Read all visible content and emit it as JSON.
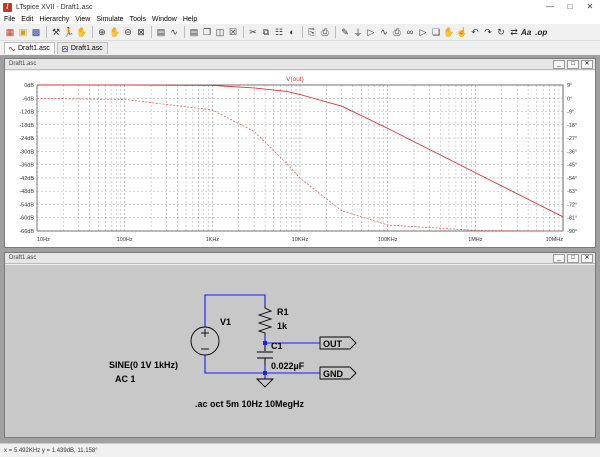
{
  "window": {
    "title": "LTspice XVII - Draft1.asc"
  },
  "menu": [
    "File",
    "Edit",
    "Hierarchy",
    "View",
    "Simulate",
    "Tools",
    "Window",
    "Help"
  ],
  "toolbar": {
    "text_tool": "Aa",
    "op_tool": ".op"
  },
  "tabs": [
    "Draft1.asc",
    "Draft1.asc"
  ],
  "waveform_window": {
    "title": "Draft1.asc"
  },
  "schematic_window": {
    "title": "Draft1.asc"
  },
  "chart_data": {
    "type": "line",
    "title": "V(out)",
    "x_scale": "log",
    "x_ticks": [
      "10Hz",
      "100Hz",
      "1KHz",
      "10KHz",
      "100KHz",
      "1MHz",
      "10MHz"
    ],
    "x_tick_values": [
      10,
      100,
      1000,
      10000,
      100000,
      1000000,
      10000000
    ],
    "xlim": [
      10,
      10000000
    ],
    "y_left_ticks": [
      "0dB",
      "-6dB",
      "-12dB",
      "-18dB",
      "-24dB",
      "-30dB",
      "-36dB",
      "-42dB",
      "-48dB",
      "-54dB",
      "-60dB",
      "-66dB"
    ],
    "y_left_lim": [
      -66,
      0
    ],
    "y_right_ticks": [
      "9°",
      "0°",
      "-9°",
      "-18°",
      "-27°",
      "-36°",
      "-45°",
      "-54°",
      "-63°",
      "-72°",
      "-81°",
      "-90°"
    ],
    "y_right_lim": [
      -90,
      9
    ],
    "grid": true,
    "series": [
      {
        "name": "magnitude",
        "axis": "left",
        "style": "solid",
        "color": "#e03030",
        "x": [
          10,
          100,
          1000,
          3000,
          7234,
          10000,
          30000,
          100000,
          1000000,
          5000000,
          10000000
        ],
        "y": [
          0,
          0,
          -0.2,
          -1.3,
          -3.0,
          -4.3,
          -9.6,
          -19.6,
          -39.6,
          -53.6,
          -59.6
        ]
      },
      {
        "name": "phase",
        "axis": "right",
        "style": "dashed",
        "color": "#e06060",
        "x": [
          10,
          100,
          1000,
          3000,
          7234,
          10000,
          30000,
          100000,
          1000000,
          10000000
        ],
        "y": [
          -0.1,
          -0.8,
          -7.9,
          -22.5,
          -45,
          -54.1,
          -76.4,
          -85.9,
          -89.6,
          -90
        ]
      }
    ]
  },
  "schematic": {
    "source_name": "V1",
    "source_value": "SINE(0 1V 1kHz)",
    "source_ac": "AC 1",
    "r1_name": "R1",
    "r1_value": "1k",
    "c1_name": "C1",
    "c1_value": "0.022µF",
    "label_out": "OUT",
    "label_gnd": "GND",
    "directive": ".ac oct 5m 10Hz 10MegHz"
  },
  "status": {
    "cursor": "x = 5.492KHz   y = 1.439dB, 11.158°"
  },
  "colors": {
    "trace": "#e03030",
    "grid": "#909090",
    "wire": "#1a1aff",
    "sch_bg": "#c8c8c8"
  }
}
